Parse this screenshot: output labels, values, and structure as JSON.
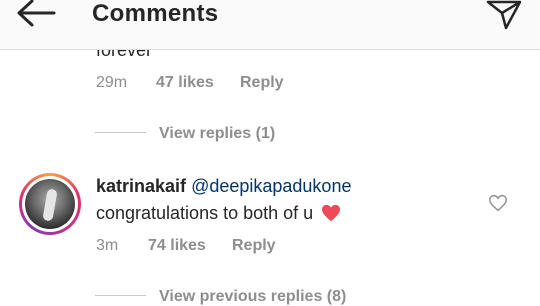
{
  "header": {
    "title": "Comments"
  },
  "previous_comment": {
    "text_partial": "forever",
    "time": "29m",
    "likes": "47 likes",
    "reply_label": "Reply",
    "view_replies": "View replies (1)"
  },
  "comment": {
    "username": "katrinakaif",
    "mention": "@deepikapadukone",
    "text": "congratulations to both of u",
    "emoji": "red-heart-emoji",
    "time": "3m",
    "likes": "74 likes",
    "reply_label": "Reply",
    "view_previous_replies": "View previous replies (8)"
  },
  "colors": {
    "mention": "#003569",
    "meta": "#8e8e8e",
    "heart": "#ed4956"
  }
}
